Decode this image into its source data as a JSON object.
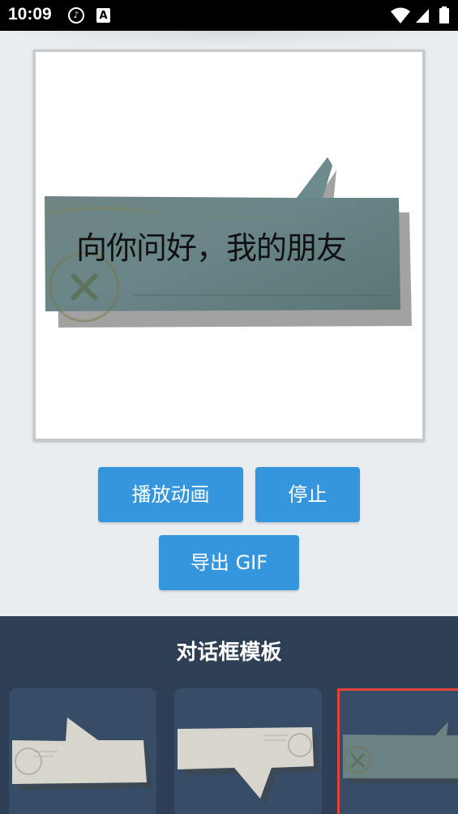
{
  "status_bar": {
    "time": "10:09",
    "icons": [
      "music-app-icon",
      "a-app-icon",
      "wifi-icon",
      "signal-icon",
      "battery-icon"
    ]
  },
  "preview": {
    "bubble_text": "向你问好，我的朋友"
  },
  "buttons": {
    "play": "播放动画",
    "stop": "停止",
    "export": "导出 GIF"
  },
  "templates_panel": {
    "title": "对话框模板",
    "templates": [
      {
        "style": "paper-bubble-tail-up"
      },
      {
        "style": "paper-bubble-tail-down"
      },
      {
        "style": "teal-stamp-bubble",
        "selected": true
      }
    ]
  },
  "colors": {
    "button": "#3596de",
    "panel": "#2e3e54",
    "card": "#364c67",
    "selected_border": "#e0453c",
    "bubble_fill": "#6a8282"
  }
}
